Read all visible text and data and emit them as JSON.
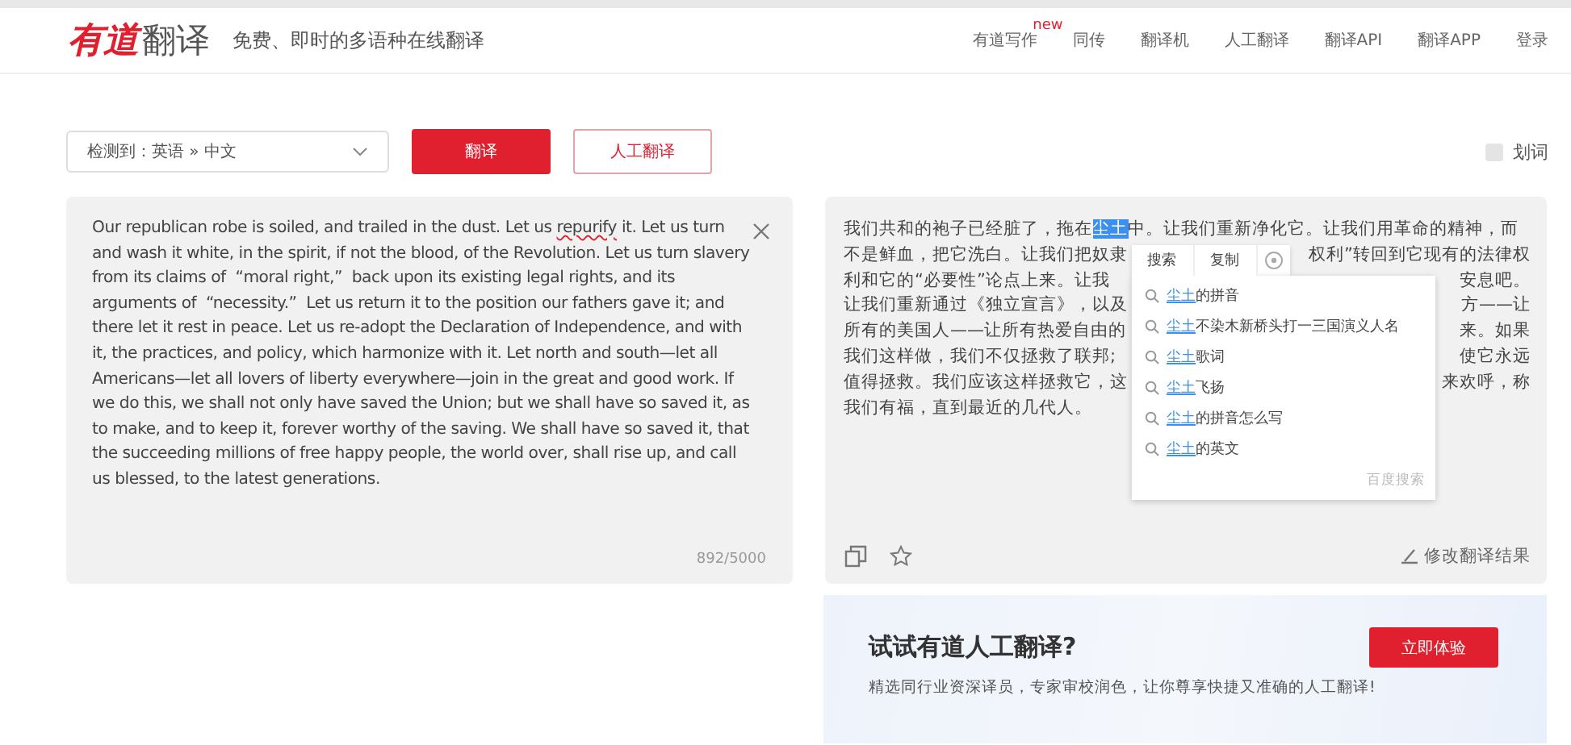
{
  "header": {
    "logo_mark": "有道",
    "logo_text": "翻译",
    "tagline": "免费、即时的多语种在线翻译",
    "nav": [
      {
        "label": "有道写作",
        "badge": "new"
      },
      {
        "label": "同传"
      },
      {
        "label": "翻译机"
      },
      {
        "label": "人工翻译"
      },
      {
        "label": "翻译API"
      },
      {
        "label": "翻译APP"
      },
      {
        "label": "登录"
      }
    ]
  },
  "toolbar": {
    "language": "检测到：英语 » 中文",
    "translate_button": "翻译",
    "human_button": "人工翻译",
    "word_pick": {
      "label": "划词",
      "checked": false
    }
  },
  "source": {
    "text": "Our republican robe is soiled, and trailed in the dust. Let us ",
    "misspelled": "repurify",
    "text_after": " it. Let us turn and wash it white, in the spirit, if not the blood, of the Revolution. Let us turn slavery from its claims of  “moral right,”  back upon its existing legal rights, and its arguments of  “necessity.”  Let us return it to the position our fathers gave it; and there let it rest in peace. Let us re-adopt the Declaration of Independence, and with it, the practices, and policy, which harmonize with it. Let north and south—let all Americans—let all lovers of liberty everywhere—join in the great and good work. If we do this, we shall not only have saved the Union; but we shall have so saved it, as to make, and to keep it, forever worthy of the saving. We shall have so saved it, that the succeeding millions of free happy people, the world over, shall rise up, and call us blessed, to the latest generations.",
    "count": "892/5000"
  },
  "result": {
    "lines": [
      {
        "left": "我们共和的袍子已经脏了，拖在",
        "selected": "尘土",
        "right": "中。让我们重新净化它。让我们用革命的精神，而"
      },
      {
        "left": "不是鲜血，把它洗白。让我们把奴隶",
        "right": "权利”转回到它现有的法律权"
      },
      {
        "left": "利和它的“必要性”论点上来。让我",
        "right": "安息吧。"
      },
      {
        "left": "让我们重新通过《独立宣言》，以及",
        "right": "方——让"
      },
      {
        "left": "所有的美国人——让所有热爱自由的",
        "right": "来。如果"
      },
      {
        "left": "我们这样做，我们不仅拯救了联邦;",
        "right": "使它永远"
      },
      {
        "left": "值得拯救。我们应该这样拯救它，这",
        "right": "来欢呼，称"
      },
      {
        "left": "我们有福，直到最近的几代人。"
      }
    ],
    "edit_link": "修改翻译结果"
  },
  "popup": {
    "actions": [
      "搜索",
      "复制"
    ],
    "suggestions": [
      {
        "term": "尘土",
        "rest": "的拼音"
      },
      {
        "term": "尘土",
        "rest": "不染木新桥头打一三国演义人名"
      },
      {
        "term": "尘土",
        "rest": "歌词"
      },
      {
        "term": "尘土",
        "rest": "飞扬"
      },
      {
        "term": "尘土",
        "rest": "的拼音怎么写"
      },
      {
        "term": "尘土",
        "rest": "的英文"
      }
    ],
    "footer": "百度搜索"
  },
  "banner": {
    "title": "试试有道人工翻译?",
    "button": "立即体验",
    "text": "精选同行业资深译员，专家审校润色，让你尊享快捷又准确的人工翻译!"
  }
}
